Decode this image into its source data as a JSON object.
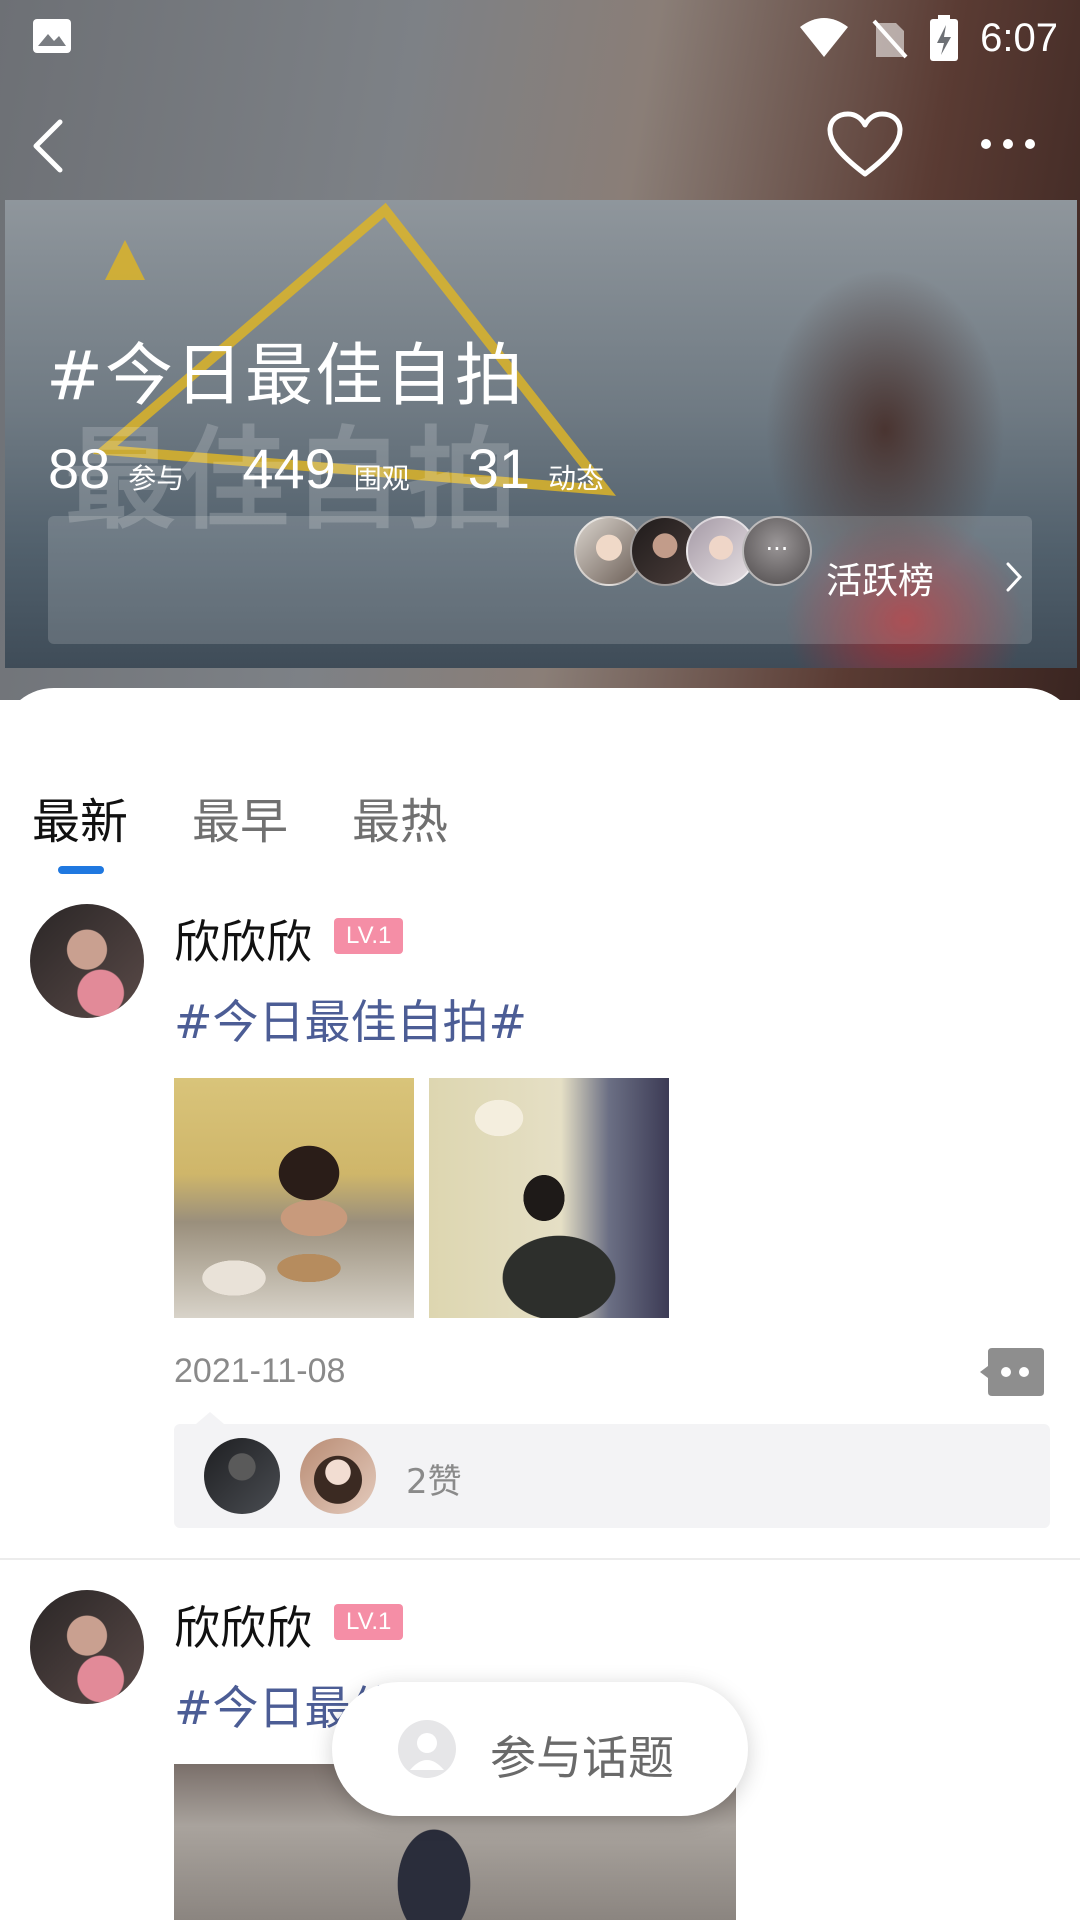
{
  "status_bar": {
    "time": "6:07",
    "icons": [
      "image-icon",
      "wifi-icon",
      "no-sim-icon",
      "battery-charging-icon"
    ]
  },
  "nav": {
    "back_icon": "chevron-left-icon",
    "favorite_icon": "heart-icon",
    "more_icon": "more-icon"
  },
  "topic": {
    "title": "#今日最佳自拍",
    "banner_overlay_text": "最佳自拍",
    "stats": [
      {
        "value": "88",
        "label": "参与"
      },
      {
        "value": "449",
        "label": "围观"
      },
      {
        "value": "31",
        "label": "动态"
      }
    ],
    "rank_label": "活跃榜",
    "rank_more_glyph": "···"
  },
  "tabs": [
    {
      "label": "最新",
      "active": true
    },
    {
      "label": "最早",
      "active": false
    },
    {
      "label": "最热",
      "active": false
    }
  ],
  "posts": [
    {
      "username": "欣欣欣",
      "level": "LV.1",
      "hashtag": "#今日最佳自拍#",
      "date": "2021-11-08",
      "likes_text": "2赞"
    },
    {
      "username": "欣欣欣",
      "level": "LV.1",
      "hashtag": "#今日最佳自拍"
    }
  ],
  "join_button": {
    "label": "参与话题"
  },
  "colors": {
    "tab_indicator": "#1f78e0",
    "hashtag": "#4c5d95",
    "level_badge": "#f58ea6"
  }
}
